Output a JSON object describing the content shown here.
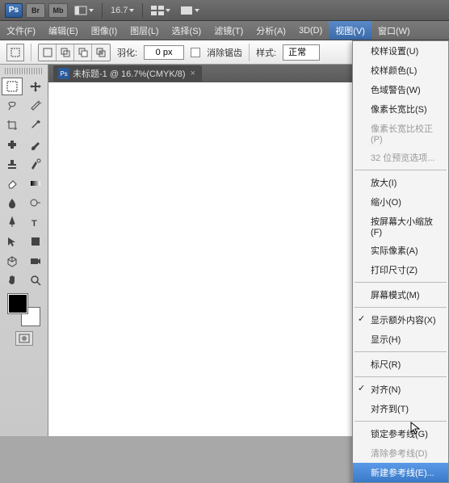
{
  "topbar": {
    "logo": "Ps",
    "br": "Br",
    "mb": "Mb",
    "zoom": "16.7"
  },
  "menubar": {
    "file": "文件(F)",
    "edit": "编辑(E)",
    "image": "图像(I)",
    "layer": "图层(L)",
    "select": "选择(S)",
    "filter": "滤镜(T)",
    "analysis": "分析(A)",
    "threed": "3D(D)",
    "view": "视图(V)",
    "window": "窗口(W)"
  },
  "optbar": {
    "feather_label": "羽化:",
    "feather_value": "0 px",
    "antialias": "消除锯齿",
    "style_label": "样式:",
    "style_value": "正常"
  },
  "document": {
    "title": "未标题-1 @ 16.7%(CMYK/8)"
  },
  "view_menu": {
    "proof_setup": "校样设置(U)",
    "proof_colors": "校样颜色(L)",
    "gamut_warning": "色域警告(W)",
    "pixel_aspect": "像素长宽比(S)",
    "pixel_aspect_correction": "像素长宽比校正(P)",
    "preview_32": "32 位预览选项...",
    "zoom_in": "放大(I)",
    "zoom_out": "缩小(O)",
    "fit_screen": "按屏幕大小缩放(F)",
    "actual_pixels": "实际像素(A)",
    "print_size": "打印尺寸(Z)",
    "screen_mode": "屏幕模式(M)",
    "extras": "显示额外内容(X)",
    "show": "显示(H)",
    "rulers": "标尺(R)",
    "snap": "对齐(N)",
    "snap_to": "对齐到(T)",
    "lock_guides": "锁定参考线(G)",
    "clear_guides": "清除参考线(D)",
    "new_guide": "新建参考线(E)..."
  }
}
